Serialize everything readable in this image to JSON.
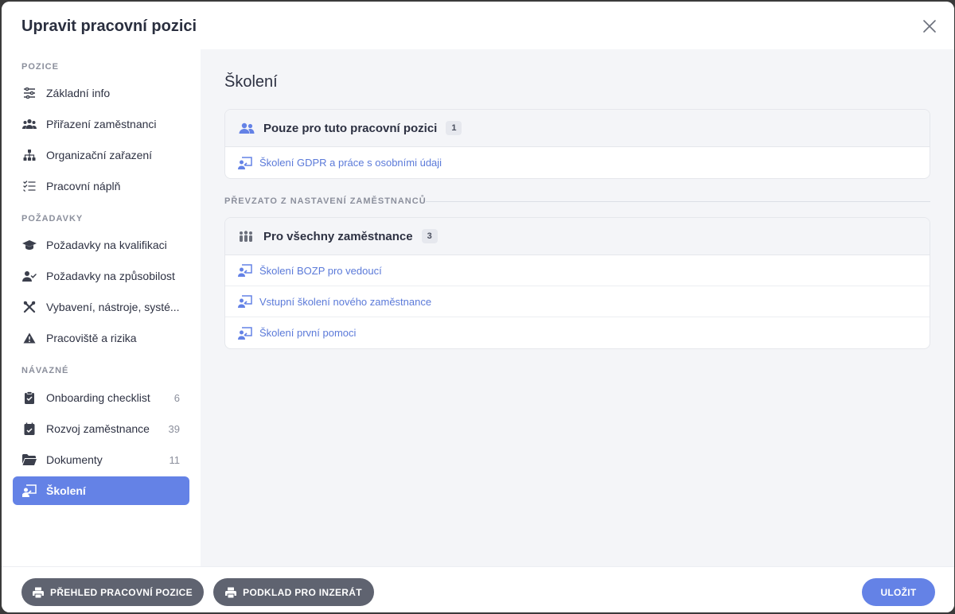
{
  "modal": {
    "title": "Upravit pracovní pozici"
  },
  "sidebar": {
    "sections": [
      {
        "label": "POZICE"
      },
      {
        "label": "POŽADAVKY"
      },
      {
        "label": "NÁVAZNÉ"
      }
    ],
    "items": [
      {
        "label": "Základní info",
        "icon": "sliders-icon"
      },
      {
        "label": "Přiřazení zaměstnanci",
        "icon": "users-icon"
      },
      {
        "label": "Organizační zařazení",
        "icon": "org-chart-icon"
      },
      {
        "label": "Pracovní náplň",
        "icon": "checklist-icon"
      },
      {
        "label": "Požadavky na kvalifikaci",
        "icon": "graduation-cap-icon"
      },
      {
        "label": "Požadavky na způsobilost",
        "icon": "user-check-icon"
      },
      {
        "label": "Vybavení, nástroje, systé...",
        "icon": "tools-icon"
      },
      {
        "label": "Pracoviště a rizika",
        "icon": "warning-icon"
      },
      {
        "label": "Onboarding checklist",
        "count": "6",
        "icon": "clipboard-check-icon"
      },
      {
        "label": "Rozvoj zaměstnance",
        "count": "39",
        "icon": "calendar-check-icon"
      },
      {
        "label": "Dokumenty",
        "count": "11",
        "icon": "folder-icon"
      },
      {
        "label": "Školení",
        "icon": "training-icon",
        "active": true
      }
    ]
  },
  "main": {
    "title": "Školení",
    "own_card": {
      "heading": "Pouze pro tuto pracovní pozici",
      "count": "1",
      "items": [
        "Školení GDPR a práce s osobními údaji"
      ]
    },
    "inherited_label": "PŘEVZATO Z NASTAVENÍ ZAMĚSTNANCŮ",
    "all_card": {
      "heading": "Pro všechny zaměstnance",
      "count": "3",
      "items": [
        "Školení BOZP pro vedoucí",
        "Vstupní školení nového zaměstnance",
        "Školení první pomoci"
      ]
    }
  },
  "footer": {
    "overview_button": "PŘEHLED PRACOVNÍ POZICE",
    "ad_button": "PODKLAD PRO INZERÁT",
    "save_button": "ULOŽIT"
  },
  "colors": {
    "accent": "#6482e6",
    "link": "#5b7ad9",
    "dark_button": "#5f6370"
  }
}
